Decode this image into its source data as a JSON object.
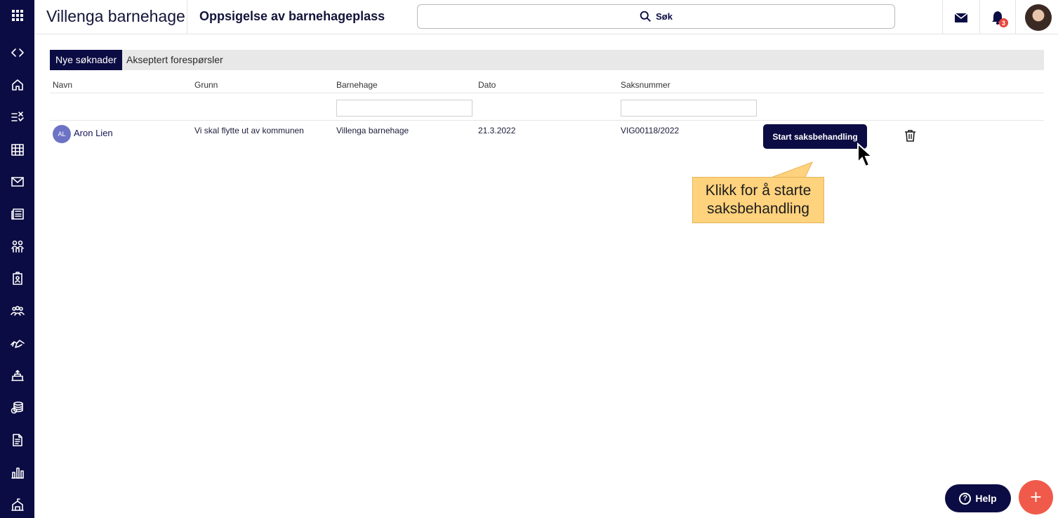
{
  "header": {
    "org_name": "Villenga barnehage",
    "page_title": "Oppsigelse av barnehageplass",
    "search_label": "Søk",
    "notification_count": "3"
  },
  "sidebar": {
    "icons": [
      "apps-grid-icon",
      "code-toggle-icon",
      "home-icon",
      "tasks-icon",
      "calendar-icon",
      "mail-icon",
      "news-icon",
      "children-icon",
      "badge-icon",
      "groups-icon",
      "handshake-icon",
      "kindergarten-icon",
      "finance-icon",
      "document-icon",
      "statistics-icon",
      "building-icon"
    ]
  },
  "tabs": [
    {
      "label": "Nye søknader",
      "active": true
    },
    {
      "label": "Akseptert forespørsler",
      "active": false
    }
  ],
  "table": {
    "columns": [
      "Navn",
      "Grunn",
      "Barnehage",
      "Dato",
      "Saksnummer"
    ],
    "rows": [
      {
        "initials": "AL",
        "name": "Aron Lien",
        "reason": "Vi skal flytte ut av kommunen",
        "kindergarten": "Villenga barnehage",
        "date": "21.3.2022",
        "case_number": "VIG00118/2022",
        "action_label": "Start saksbehandling"
      }
    ]
  },
  "callout": {
    "line1": "Klikk for å starte",
    "line2": "saksbehandling"
  },
  "help_label": "Help",
  "add_label": "+",
  "colors": {
    "primary": "#0c0c44",
    "accent": "#f05a4a",
    "callout": "#ffd27d",
    "avatar": "#6d73c4"
  }
}
